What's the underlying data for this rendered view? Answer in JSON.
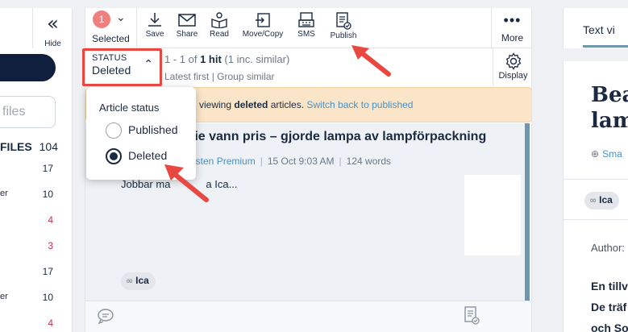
{
  "left_panel": {
    "hide_label": "Hide",
    "search_placeholder": "files",
    "files_heading": "FILES",
    "files_count": "104",
    "rows": [
      {
        "text": "",
        "count": "17",
        "count_color": "#1b2a40"
      },
      {
        "text": "er",
        "count": "10",
        "count_color": "#1b2a40"
      },
      {
        "text": "",
        "count": "4",
        "count_color": "#c0304a"
      },
      {
        "text": "",
        "count": "3",
        "count_color": "#c0304a"
      },
      {
        "text": "",
        "count": "17",
        "count_color": "#1b2a40"
      },
      {
        "text": "er",
        "count": "10",
        "count_color": "#1b2a40"
      },
      {
        "text": "",
        "count": "4",
        "count_color": "#c0304a"
      }
    ]
  },
  "toolbar": {
    "selected_count": "1",
    "selected_label": "Selected",
    "save_label": "Save",
    "share_label": "Share",
    "read_label": "Read",
    "move_copy_label": "Move/Copy",
    "sms_label": "SMS",
    "publish_label": "Publish",
    "more_label": "More"
  },
  "status": {
    "key": "STATUS",
    "value": "Deleted",
    "hits_prefix": "1 - 1 of ",
    "hits_bold": "1 hit",
    "hits_suffix": " (1 inc. similar)",
    "sort_label": "Latest first",
    "group_label": "Group similar",
    "display_label": "Display"
  },
  "banner": {
    "prefix": "viewing ",
    "bold": "deleted",
    "mid": " articles. ",
    "link": "Switch back to published"
  },
  "article": {
    "title": "fie vann pris – gjorde lampa av lampförpackning",
    "source": "osten Premium",
    "date": "15 Oct 9:03 AM",
    "words": "124 words",
    "snippet": "Jobbar ma",
    "snippet_rest": "a Ica...",
    "tag": "Ica"
  },
  "popover": {
    "heading": "Article status",
    "options": [
      {
        "label": "Published",
        "selected": false
      },
      {
        "label": "Deleted",
        "selected": true
      }
    ]
  },
  "right_panel": {
    "tab_label": "Text vi",
    "title_line1": "Bea",
    "title_line2": "lam",
    "sm_label": "Sma",
    "tag": "Ica",
    "author_label": "Author:",
    "body_lines": [
      "En tillv",
      "De träf",
      "och So"
    ]
  },
  "colors": {
    "accent_red": "#e8483f",
    "badge": "#f07f7f",
    "banner_bg": "#fbe5c8",
    "dark_pill": "#0f1f3d",
    "link": "#4a90c4"
  }
}
